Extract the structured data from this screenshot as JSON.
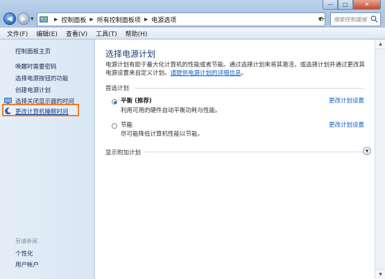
{
  "window": {
    "controls": {
      "minimize": "—",
      "maximize": "□",
      "close": "✕"
    }
  },
  "address": {
    "breadcrumbs": [
      "控制面板",
      "所有控制面板项",
      "电源选项"
    ],
    "search_placeholder": "搜索控制面板"
  },
  "menubar": {
    "items": [
      "文件(F)",
      "编辑(E)",
      "查看(V)",
      "工具(T)",
      "帮助(H)"
    ]
  },
  "sidebar": {
    "home": "控制面板主页",
    "items": [
      "唤醒时需要密码",
      "选择电源按钮的功能",
      "创建电源计划",
      "选择关闭显示器的时间",
      "更改计算机睡眠时间"
    ],
    "see_also_label": "另请参阅",
    "bottom_items": [
      "个性化",
      "用户帐户"
    ]
  },
  "main": {
    "title": "选择电源计划",
    "description": "电源计划有助于最大化计算机的性能或者节能。通过选择计划来将其激活，或选择计划并通过更改其电源设置来自定义计划。",
    "description_link": "请提供电源计划的详细信息",
    "description_end": "。",
    "preferred_label": "首选计划",
    "plans": [
      {
        "name": "平衡 (推荐)",
        "description": "利用可用的硬件自动平衡功耗与性能。",
        "selected": true,
        "link": "更改计划设置"
      },
      {
        "name": "节能",
        "description": "尽可能降低计算机性能以节能。",
        "selected": false,
        "link": "更改计划设置"
      }
    ],
    "more_plans_label": "显示附加计划"
  },
  "colors": {
    "accent_link": "#0b5ec8",
    "highlight_border": "#f07b23",
    "title": "#1c3a72"
  },
  "icons": {
    "back": "back-arrow-icon",
    "forward": "forward-arrow-icon",
    "refresh": "refresh-icon",
    "search": "search-icon",
    "expand": "chevron-down-icon"
  }
}
